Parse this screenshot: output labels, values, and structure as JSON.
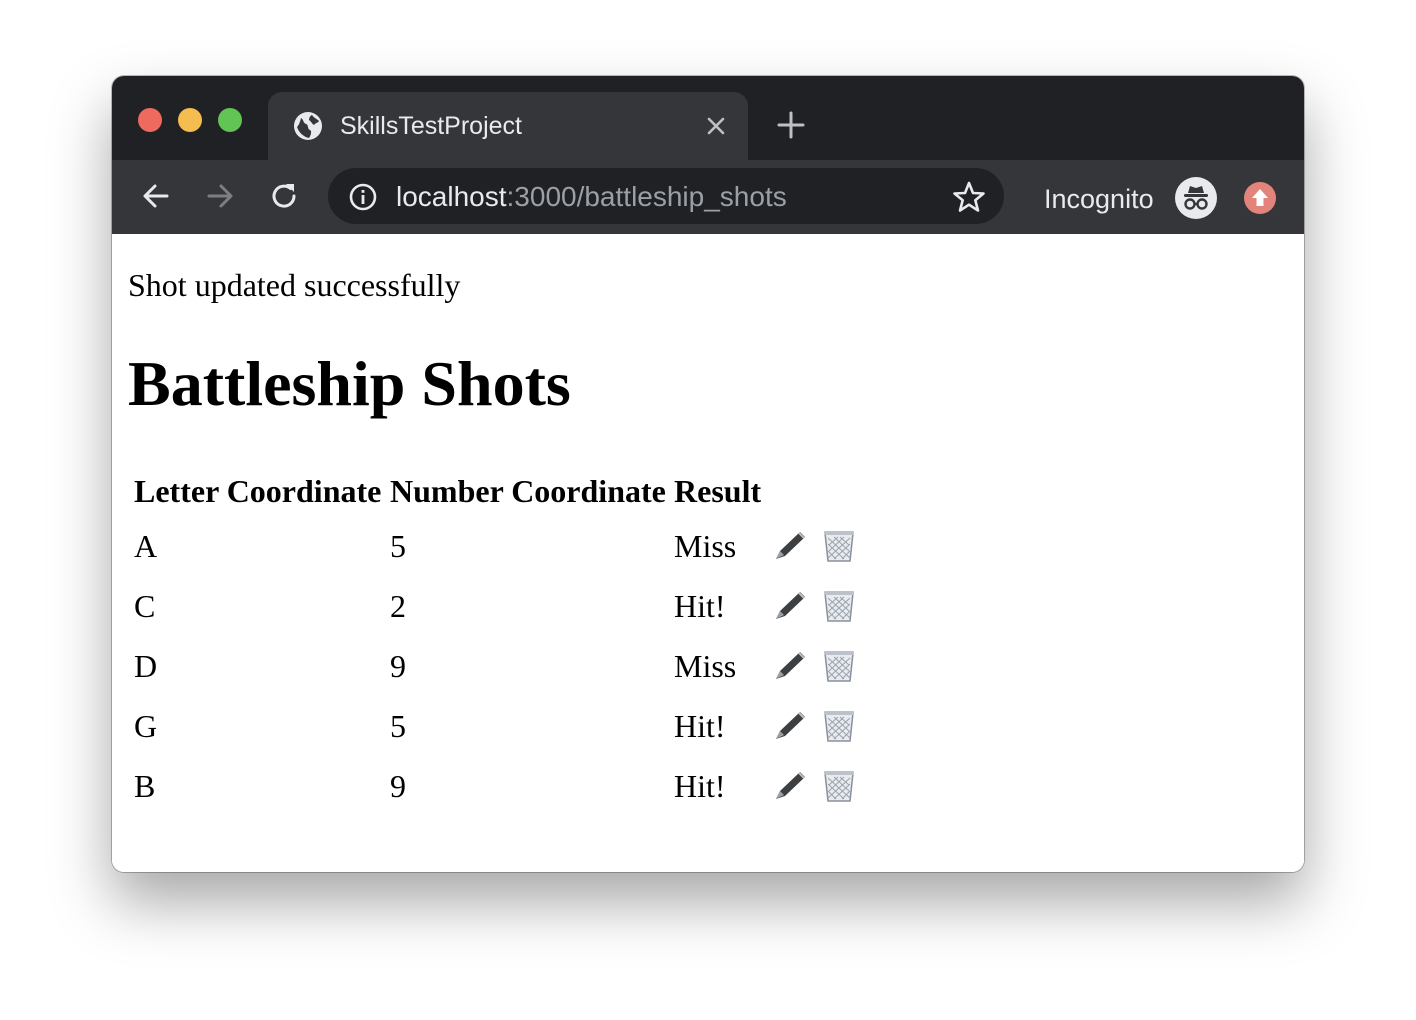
{
  "browser": {
    "tab_title": "SkillsTestProject",
    "url_host": "localhost",
    "url_path": ":3000/battleship_shots",
    "profile_label": "Incognito"
  },
  "page": {
    "notice": "Shot updated successfully",
    "heading": "Battleship Shots",
    "table": {
      "headers": [
        "Letter Coordinate",
        "Number Coordinate",
        "Result"
      ],
      "rows": [
        {
          "letter": "A",
          "number": "5",
          "result": "Miss"
        },
        {
          "letter": "C",
          "number": "2",
          "result": "Hit!"
        },
        {
          "letter": "D",
          "number": "9",
          "result": "Miss"
        },
        {
          "letter": "G",
          "number": "5",
          "result": "Hit!"
        },
        {
          "letter": "B",
          "number": "9",
          "result": "Hit!"
        }
      ],
      "row_actions": [
        "edit-pen-icon",
        "delete-trash-icon"
      ]
    }
  },
  "colors": {
    "titlebar": "#202124",
    "toolbar": "#35363a",
    "link": "#1a0dab",
    "traffic_red": "#ee6a5f",
    "traffic_yellow": "#f5bd4f",
    "traffic_green": "#61c454"
  }
}
